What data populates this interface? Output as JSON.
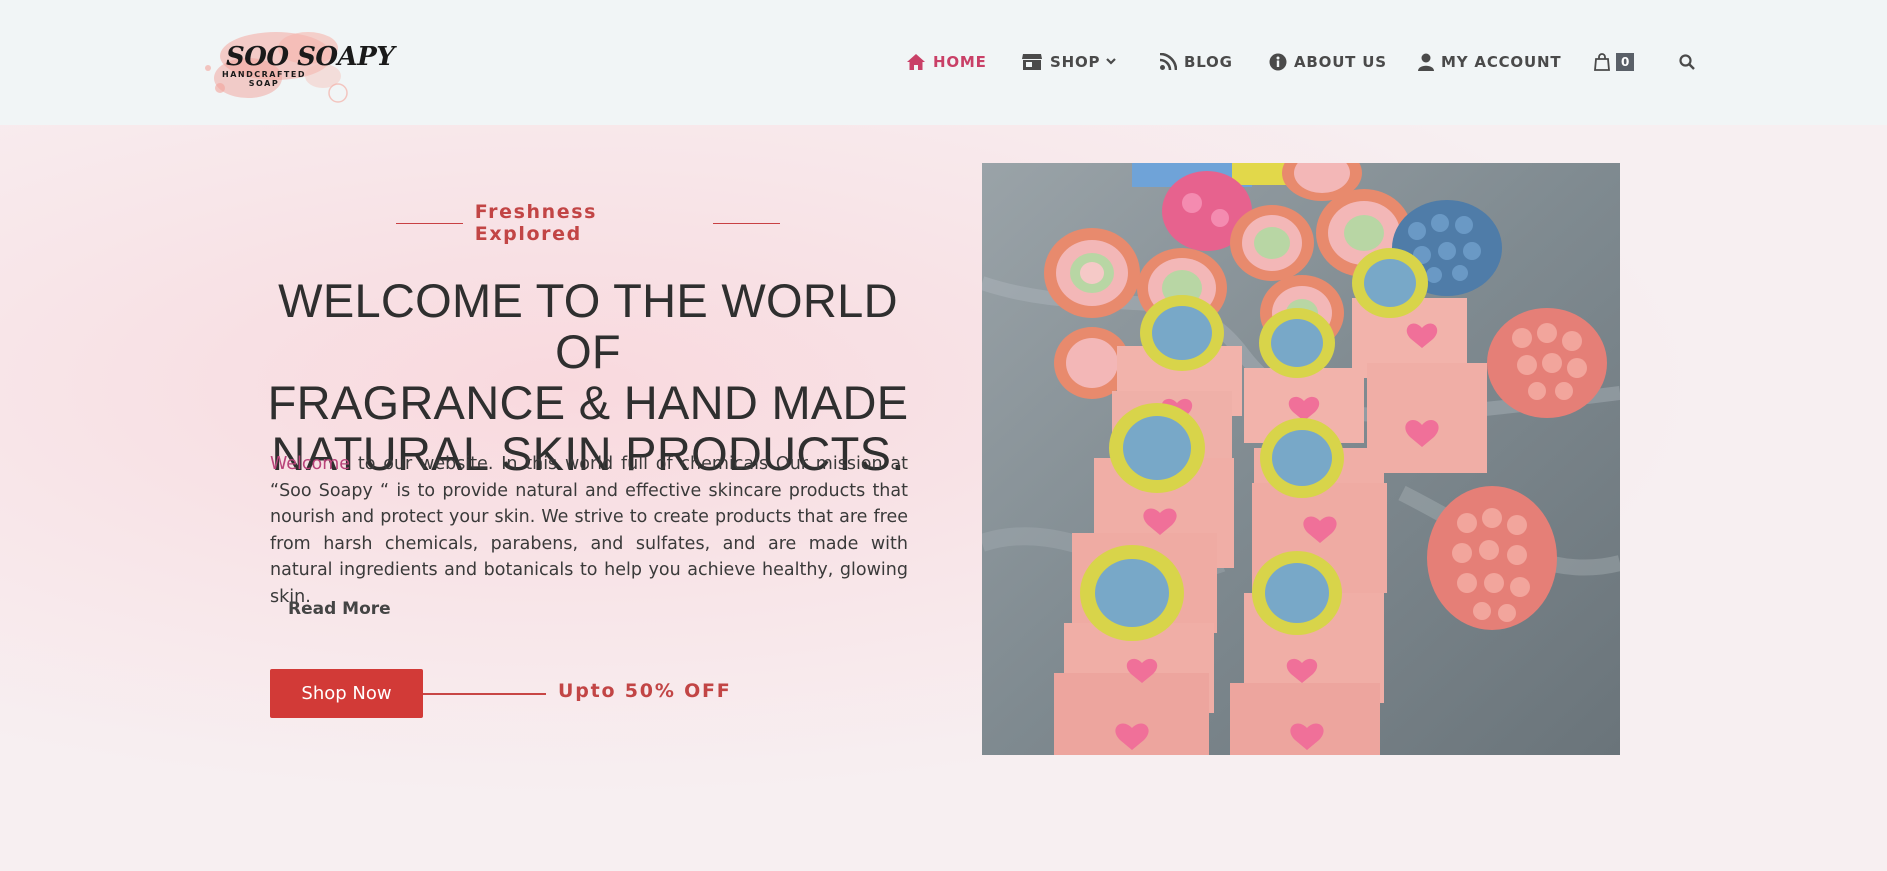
{
  "logo": {
    "title": "SOO SOAPY",
    "subtitle_line1": "HANDCRAFTED",
    "subtitle_line2": "SOAP"
  },
  "nav": {
    "items": [
      {
        "label": "HOME",
        "icon": "home-icon",
        "active": true
      },
      {
        "label": "SHOP",
        "icon": "store-icon",
        "dropdown": true
      },
      {
        "label": "BLOG",
        "icon": "rss-icon"
      },
      {
        "label": "ABOUT US",
        "icon": "info-icon"
      },
      {
        "label": "MY ACCOUNT",
        "icon": "user-icon"
      }
    ],
    "cart_count": "0",
    "search_icon": "search-icon"
  },
  "hero": {
    "eyebrow": "Freshness Explored",
    "headline_line1": "WELCOME TO THE WORLD OF",
    "headline_line2": "FRAGRANCE & HAND MADE",
    "headline_line3": "NATURAL SKIN PRODUCTS.",
    "intro_accent": "Welcome",
    "intro_text": " to our website. In this world full of chemicals Our mission at “Soo Soapy “ is to provide natural and effective skincare products that nourish and protect your skin. We strive to create products that are free from harsh chemicals, parabens, and sulfates, and are made with natural ingredients and botanicals to help you achieve healthy, glowing skin.",
    "read_more": "Read More",
    "cta_label": "Shop Now",
    "promo": "Upto 50% OFF"
  },
  "colors": {
    "accent_red": "#d23a37",
    "active_nav": "#c94067",
    "header_bg": "#f1f5f6",
    "hero_bg": "#f9dde2"
  }
}
